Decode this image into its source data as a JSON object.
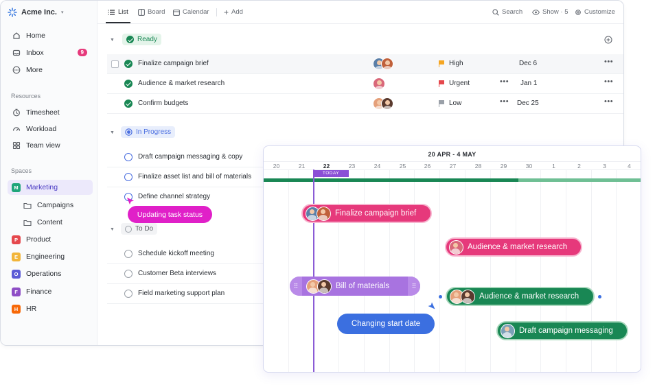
{
  "workspace": {
    "name": "Acme Inc."
  },
  "sidebar": {
    "nav": [
      {
        "label": "Home",
        "icon": "home-icon"
      },
      {
        "label": "Inbox",
        "icon": "inbox-icon",
        "badge": "9"
      },
      {
        "label": "More",
        "icon": "more-icon"
      }
    ],
    "resources_title": "Resources",
    "resources": [
      {
        "label": "Timesheet",
        "icon": "timesheet-icon"
      },
      {
        "label": "Workload",
        "icon": "workload-icon"
      },
      {
        "label": "Team view",
        "icon": "team-view-icon"
      }
    ],
    "spaces_title": "Spaces",
    "spaces": [
      {
        "label": "Marketing",
        "letter": "M",
        "color": "#1fa67a"
      },
      {
        "label": "Campaigns",
        "folder": true
      },
      {
        "label": "Content",
        "folder": true
      },
      {
        "label": "Product",
        "letter": "P",
        "color": "#e5484d"
      },
      {
        "label": "Engineering",
        "letter": "E",
        "color": "#f2b53a"
      },
      {
        "label": "Operations",
        "letter": "O",
        "color": "#5b5bd6"
      },
      {
        "label": "Finance",
        "letter": "F",
        "color": "#8e4ec6"
      },
      {
        "label": "HR",
        "letter": "H",
        "color": "#f76808"
      }
    ]
  },
  "toolbar": {
    "list": "List",
    "board": "Board",
    "calendar": "Calendar",
    "add": "Add",
    "search": "Search",
    "show": "Show · 5",
    "customize": "Customize"
  },
  "groups": {
    "ready": "Ready",
    "in_progress": "In Progress",
    "todo": "To Do"
  },
  "tasks": {
    "ready": [
      {
        "name": "Finalize campaign brief",
        "priority": "High",
        "priority_color": "#f5a623",
        "date": "Dec 6"
      },
      {
        "name": "Audience & market research",
        "priority": "Urgent",
        "priority_color": "#e5484d",
        "date": "Jan 1"
      },
      {
        "name": "Confirm budgets",
        "priority": "Low",
        "priority_color": "#9aa0a8",
        "date": "Dec 25"
      }
    ],
    "in_progress": [
      {
        "name": "Draft campaign messaging & copy"
      },
      {
        "name": "Finalize asset list and bill of materials"
      },
      {
        "name": "Define channel strategy"
      }
    ],
    "todo": [
      {
        "name": "Schedule kickoff meeting"
      },
      {
        "name": "Customer Beta interviews"
      },
      {
        "name": "Field marketing support plan"
      }
    ]
  },
  "updating_tooltip": "Updating task status",
  "gantt": {
    "range": "20 APR - 4 MAY",
    "days": [
      "20",
      "21",
      "22",
      "23",
      "24",
      "25",
      "26",
      "27",
      "28",
      "29",
      "30",
      "1",
      "2",
      "3",
      "4"
    ],
    "today_label": "TODAY",
    "bars": [
      {
        "label": "Finalize campaign brief",
        "color": "#e6397b"
      },
      {
        "label": "Audience & market research",
        "color": "#e6397b"
      },
      {
        "label": "Bill of materials",
        "color": "#a873e0"
      },
      {
        "label": "Audience & market research",
        "color": "#198754"
      },
      {
        "label": "Draft campaign messaging",
        "color": "#198754"
      }
    ],
    "changing_tooltip": "Changing start date"
  },
  "colors": {
    "accent": "#7b68ee",
    "ready_green": "#198754",
    "progress_blue": "#4a6ee0",
    "tooltip_pink": "#e020c8",
    "tooltip_blue": "#3b6fe0"
  }
}
